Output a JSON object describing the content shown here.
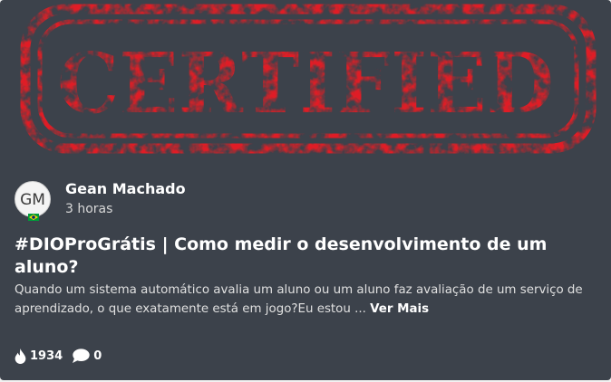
{
  "banner": {
    "stamp_text": "CERTIFIED",
    "stamp_color": "#e01e25"
  },
  "author": {
    "initials": "GM",
    "name": "Gean Machado",
    "time": "3 horas"
  },
  "post": {
    "title": "#DIOProGrátis | Como medir o desenvolvimento de um aluno?",
    "excerpt": "Quando um sistema automático avalia um aluno ou um aluno faz avaliação de um serviço de aprendizado, o que exatamente está em jogo?Eu estou ... ",
    "read_more": "Ver Mais"
  },
  "stats": {
    "likes": "1934",
    "comments": "0"
  },
  "colors": {
    "card_bg": "#3c424b",
    "accent_red": "#e01e25",
    "text_white": "#ffffff"
  },
  "icons": [
    "flame-icon",
    "comment-icon",
    "brazil-flag-icon"
  ]
}
